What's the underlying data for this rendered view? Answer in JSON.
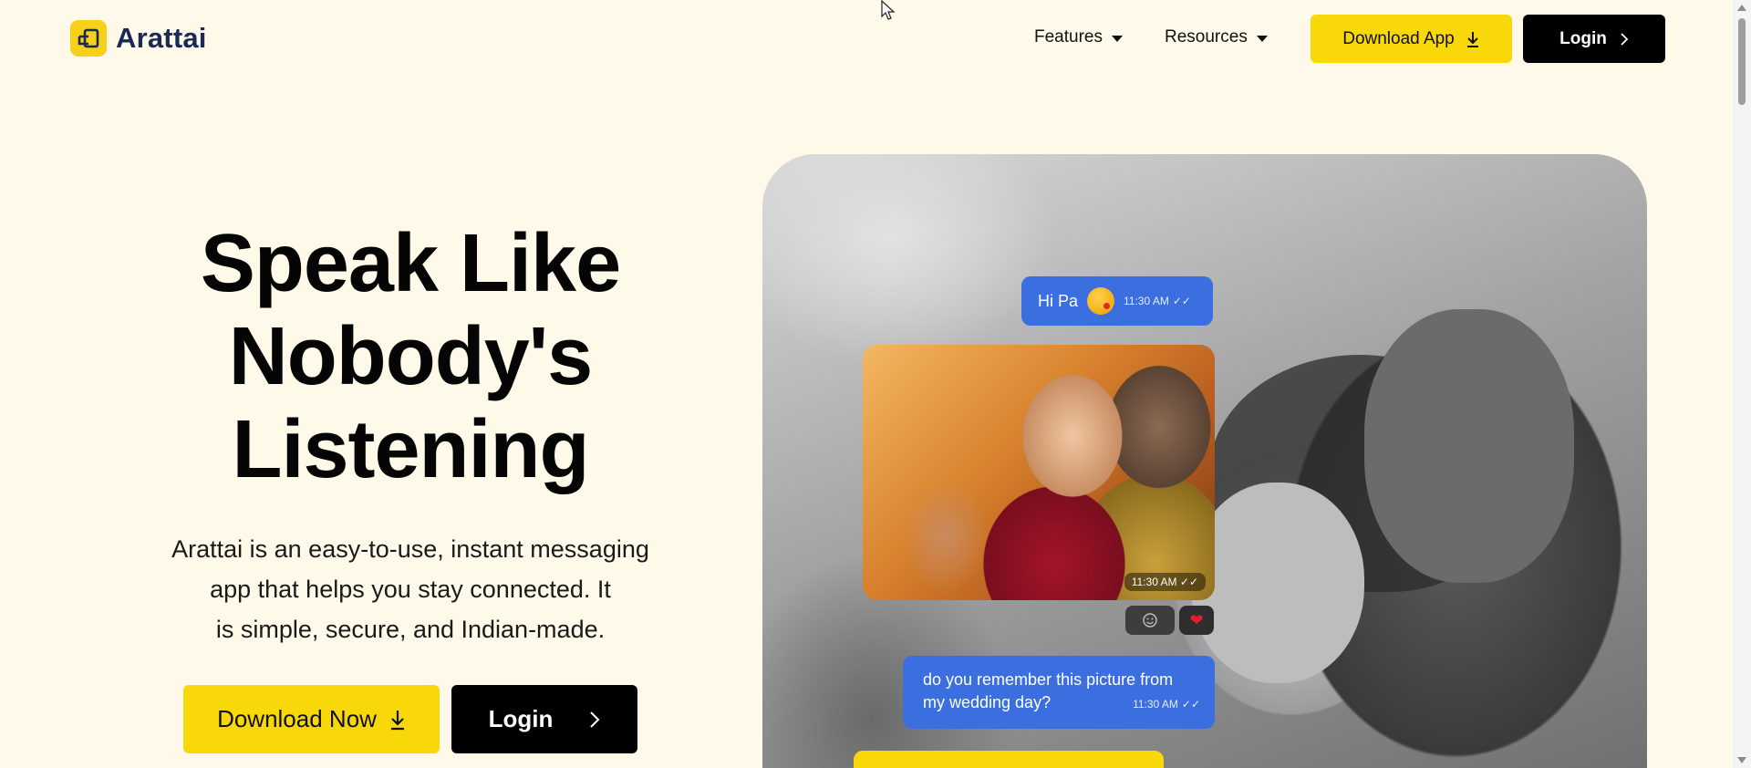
{
  "brand": {
    "name": "Arattai"
  },
  "nav": {
    "features": "Features",
    "resources": "Resources",
    "download_app": "Download App",
    "login": "Login"
  },
  "hero": {
    "title_lines": [
      "Speak Like",
      "Nobody's",
      "Listening"
    ],
    "description_lines": [
      "Arattai is an easy-to-use, instant messaging",
      "app that helps you stay connected. It",
      "is simple, secure, and Indian-made."
    ],
    "download_now": "Download Now",
    "login": "Login"
  },
  "chat": {
    "msg1": {
      "text": "Hi Pa",
      "time": "11:30 AM"
    },
    "photo": {
      "time": "11:30 AM"
    },
    "msg2": {
      "line1": "do you remember this picture from",
      "line2": "my wedding day?",
      "time": "11:30 AM"
    }
  },
  "colors": {
    "background": "#fef9e8",
    "accent_yellow": "#f9d80a",
    "bubble_blue": "#3b6fe0",
    "dark": "#000000"
  },
  "icons": [
    "logo-icon",
    "chevron-down-icon",
    "download-icon",
    "chevron-right-icon",
    "add-reaction-icon",
    "heart-icon",
    "double-check-icon"
  ]
}
